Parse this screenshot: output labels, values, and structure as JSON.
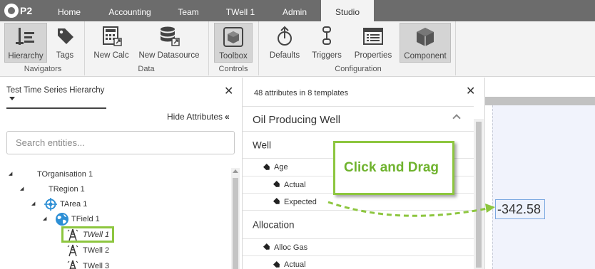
{
  "logo": {
    "text": "P2"
  },
  "nav": {
    "tabs": [
      {
        "label": "Home"
      },
      {
        "label": "Accounting"
      },
      {
        "label": "Team"
      },
      {
        "label": "TWell 1"
      },
      {
        "label": "Admin"
      },
      {
        "label": "Studio",
        "active": true
      }
    ]
  },
  "ribbon": {
    "buttons": [
      {
        "label": "Hierarchy",
        "icon": "hierarchy-icon",
        "selected": true
      },
      {
        "label": "Tags",
        "icon": "tag-icon"
      },
      {
        "label": "New Calc",
        "icon": "calculator-icon"
      },
      {
        "label": "New Datasource",
        "icon": "database-icon"
      },
      {
        "label": "Toolbox",
        "icon": "toolbox-icon",
        "selected": true
      },
      {
        "label": "Defaults",
        "icon": "defaults-icon"
      },
      {
        "label": "Triggers",
        "icon": "triggers-icon"
      },
      {
        "label": "Properties",
        "icon": "properties-icon"
      },
      {
        "label": "Component",
        "icon": "component-icon",
        "selected": true
      }
    ],
    "groups": {
      "navigators": "Navigators",
      "data": "Data",
      "controls": "Controls",
      "configuration": "Configuration"
    }
  },
  "left_panel": {
    "hierarchy_select": "Test Time Series Hierarchy",
    "hide_attributes": "Hide Attributes",
    "search_placeholder": "Search entities...",
    "tree": [
      {
        "label": "TOrganisation 1",
        "icon": ""
      },
      {
        "label": "TRegion 1",
        "icon": ""
      },
      {
        "label": "TArea 1",
        "icon": "target-icon"
      },
      {
        "label": "TField 1",
        "icon": "globe-icon"
      },
      {
        "label": "TWell 1",
        "icon": "well-icon",
        "selected": true
      },
      {
        "label": "TWell 2",
        "icon": "well-icon"
      },
      {
        "label": "TWell 3",
        "icon": "well-icon"
      }
    ]
  },
  "mid_panel": {
    "summary": "48 attributes in 8 templates",
    "template_title": "Oil Producing Well",
    "sections": [
      {
        "title": "Well",
        "rows": [
          "Age",
          "Actual",
          "Expected"
        ]
      },
      {
        "title": "Allocation",
        "rows": [
          "Alloc Gas",
          "Actual"
        ]
      }
    ]
  },
  "canvas": {
    "value": "-342.58"
  },
  "callout": {
    "text": "Click and Drag"
  },
  "colors": {
    "accent_green": "#8dc63f",
    "callout_text": "#6fb32e",
    "nav_bg": "#6c6c6c",
    "ribbon_bg": "#f3f3f3",
    "canvas_bg": "#f1f3fc",
    "value_border": "#7aa7e0"
  }
}
